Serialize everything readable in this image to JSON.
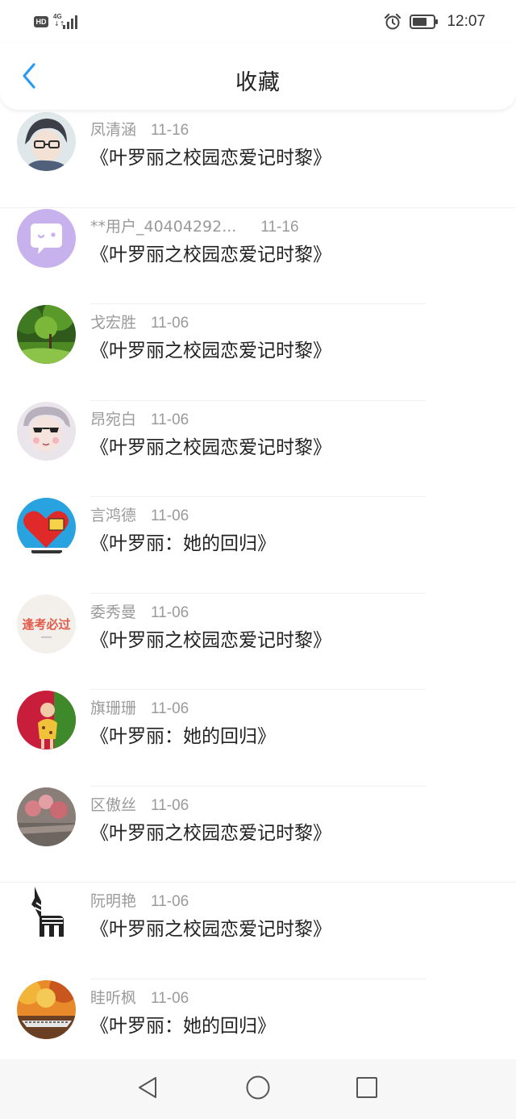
{
  "status_bar": {
    "hd": "HD",
    "network": "4G",
    "time": "12:07"
  },
  "header": {
    "title": "收藏"
  },
  "items": [
    {
      "name": "凤清涵",
      "date": "11-16",
      "book": "《叶罗丽之校园恋爱记时黎》",
      "avatar": "anime-boy"
    },
    {
      "name": "**用户_40404292...",
      "date": "11-16",
      "book": "《叶罗丽之校园恋爱记时黎》",
      "avatar": "chat-bubble"
    },
    {
      "name": "戈宏胜",
      "date": "11-06",
      "book": "《叶罗丽之校园恋爱记时黎》",
      "avatar": "forest"
    },
    {
      "name": "昂宛白",
      "date": "11-06",
      "book": "《叶罗丽之校园恋爱记时黎》",
      "avatar": "cartoon-girl"
    },
    {
      "name": "言鸿德",
      "date": "11-06",
      "book": "《叶罗丽：她的回归》",
      "avatar": "red-heart"
    },
    {
      "name": "委秀曼",
      "date": "11-06",
      "book": "《叶罗丽之校园恋爱记时黎》",
      "avatar": "text-logo",
      "avatar_text": "逢考必过"
    },
    {
      "name": "旗珊珊",
      "date": "11-06",
      "book": "《叶罗丽：她的回归》",
      "avatar": "child-photo"
    },
    {
      "name": "区傲丝",
      "date": "11-06",
      "book": "《叶罗丽之校园恋爱记时黎》",
      "avatar": "flowers"
    },
    {
      "name": "阮明艳",
      "date": "11-06",
      "book": "《叶罗丽之校园恋爱记时黎》",
      "avatar": "zebra"
    },
    {
      "name": "眭听枫",
      "date": "11-06",
      "book": "《叶罗丽：她的回归》",
      "avatar": "autumn"
    }
  ],
  "nav": {
    "back": "back-triangle",
    "home": "home-circle",
    "recent": "recent-square"
  }
}
